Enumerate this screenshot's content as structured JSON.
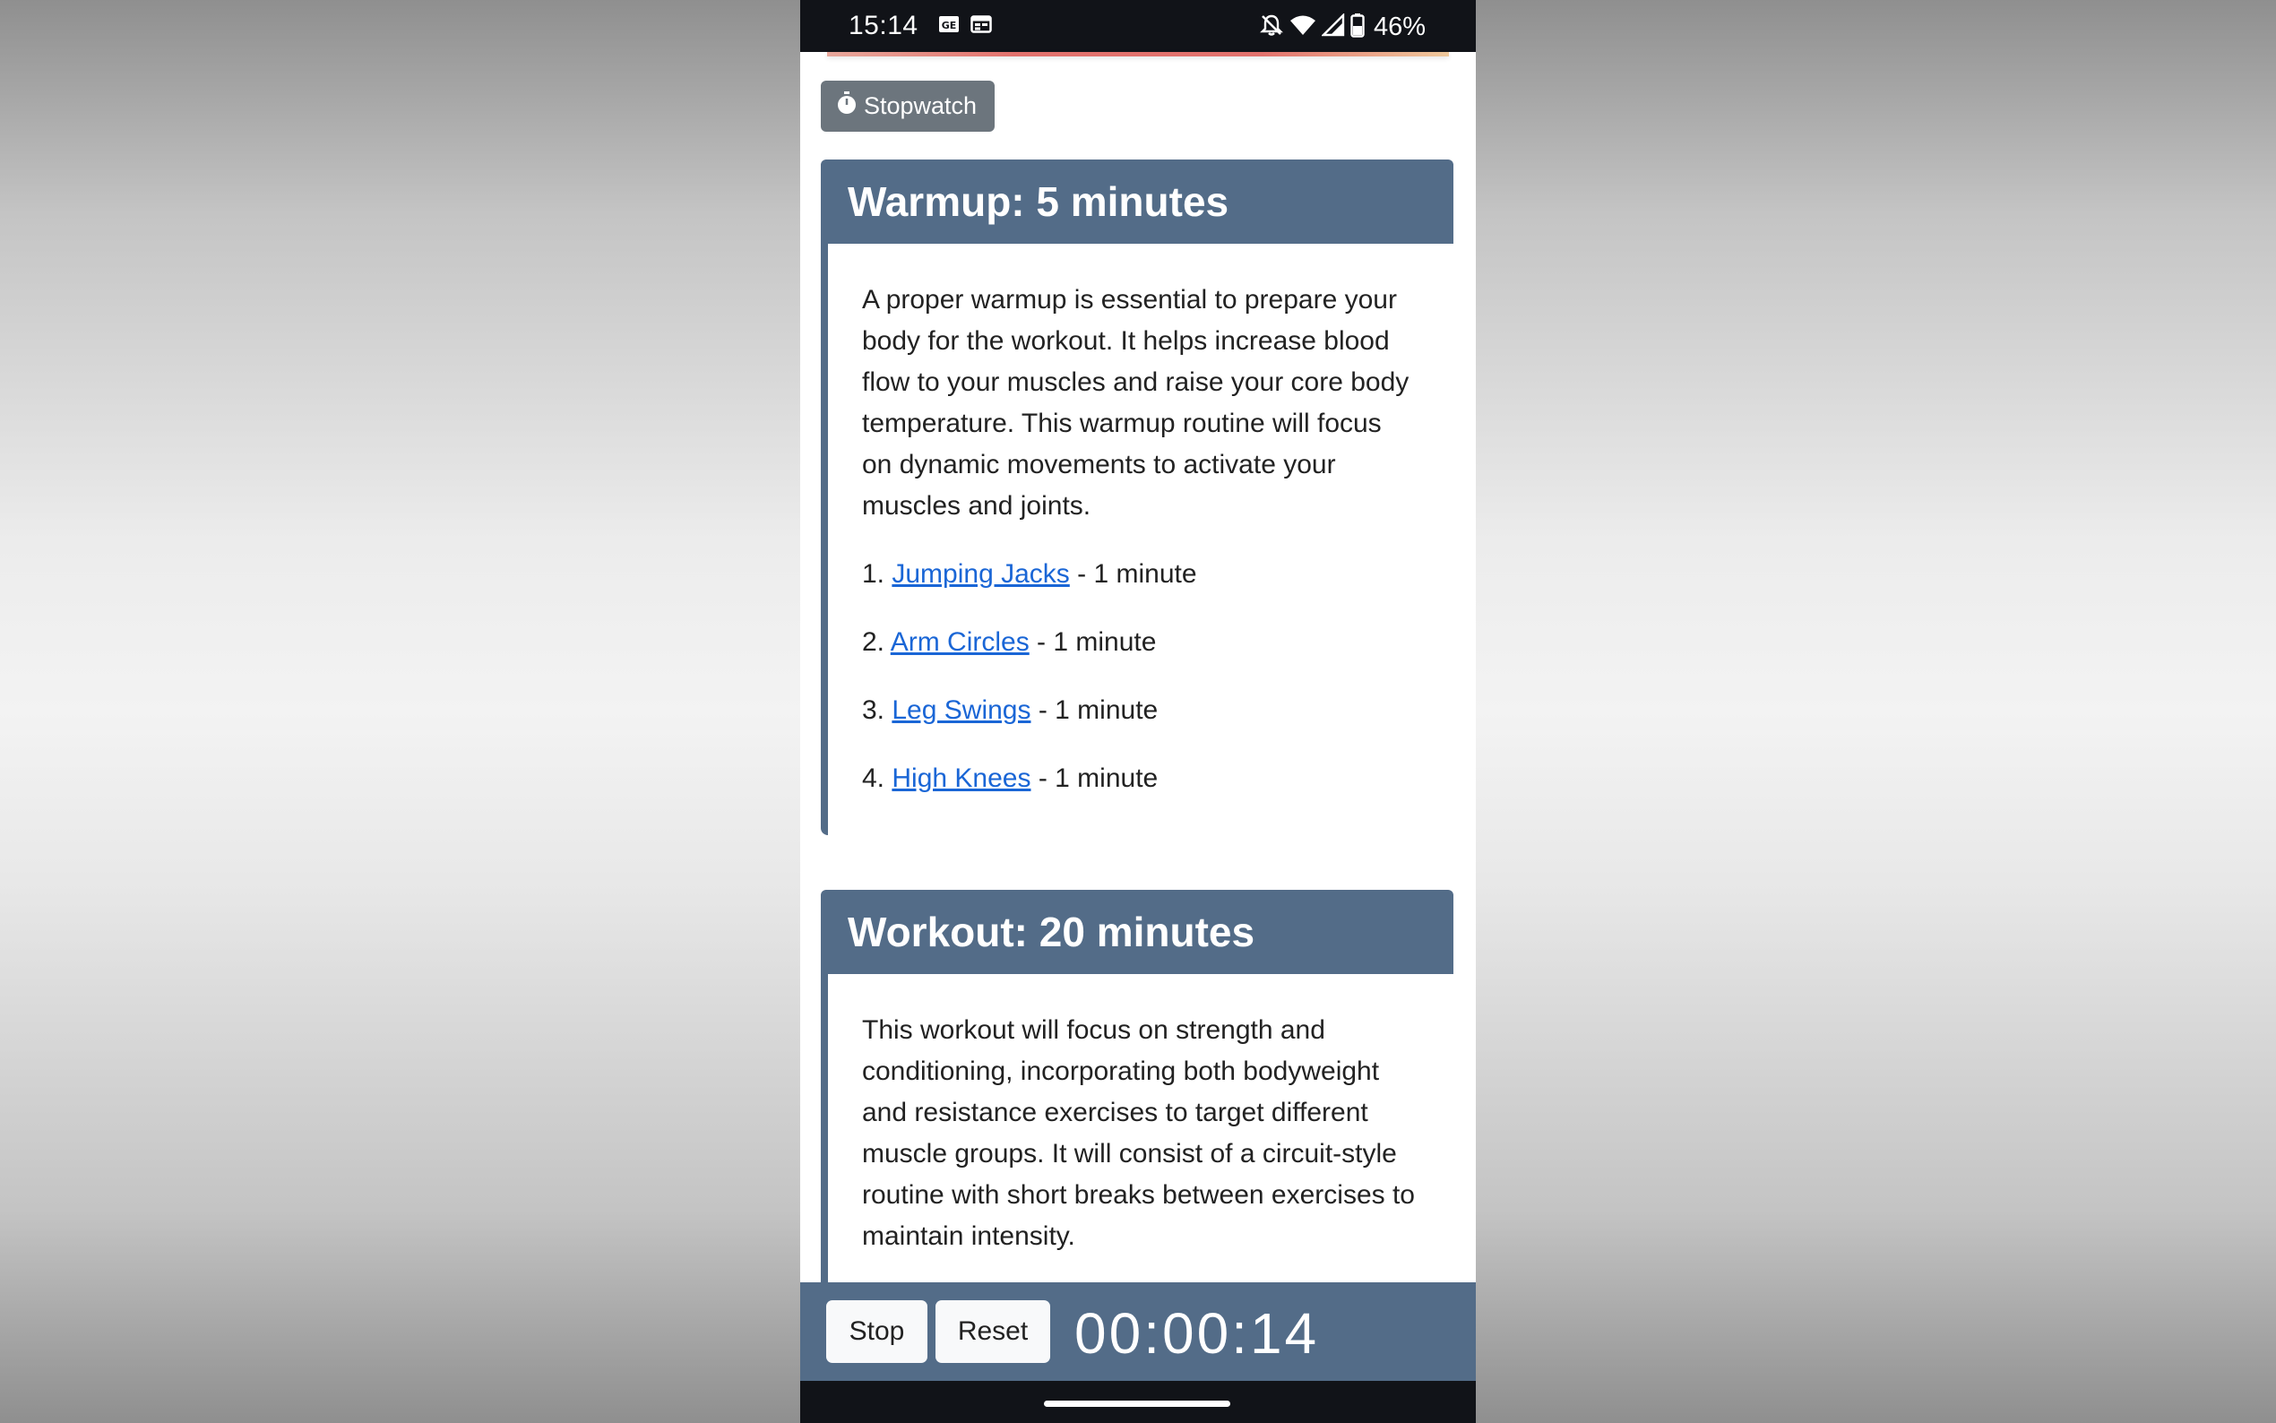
{
  "status_bar": {
    "time": "15:14",
    "battery": "46%",
    "icons": [
      "gmail-icon",
      "calendar-icon",
      "notifications-off-icon",
      "wifi-icon",
      "signal-icon",
      "battery-icon"
    ]
  },
  "stopwatch_button": {
    "label": "Stopwatch",
    "icon": "stopwatch-icon"
  },
  "sections": [
    {
      "title": "Warmup: 5 minutes",
      "description": "A proper warmup is essential to prepare your body for the workout. It helps increase blood flow to your muscles and raise your core body temperature. This warmup routine will focus on dynamic movements to activate your muscles and joints.",
      "exercises": [
        {
          "number": "1.",
          "name": "Jumping Jacks",
          "duration": " - 1 minute"
        },
        {
          "number": "2.",
          "name": "Arm Circles",
          "duration": " - 1 minute"
        },
        {
          "number": "3.",
          "name": "Leg Swings",
          "duration": " - 1 minute"
        },
        {
          "number": "4.",
          "name": "High Knees",
          "duration": " - 1 minute"
        }
      ]
    },
    {
      "title": "Workout: 20 minutes",
      "description": "This workout will focus on strength and conditioning, incorporating both bodyweight and resistance exercises to target different muscle groups. It will consist of a circuit-style routine with short breaks between exercises to maintain intensity."
    }
  ],
  "controls": {
    "stop_label": "Stop",
    "reset_label": "Reset",
    "timer": "00:00:14"
  },
  "colors": {
    "header": "#536c88",
    "link": "#1a66d6",
    "stopwatch_button": "#6c757d"
  }
}
